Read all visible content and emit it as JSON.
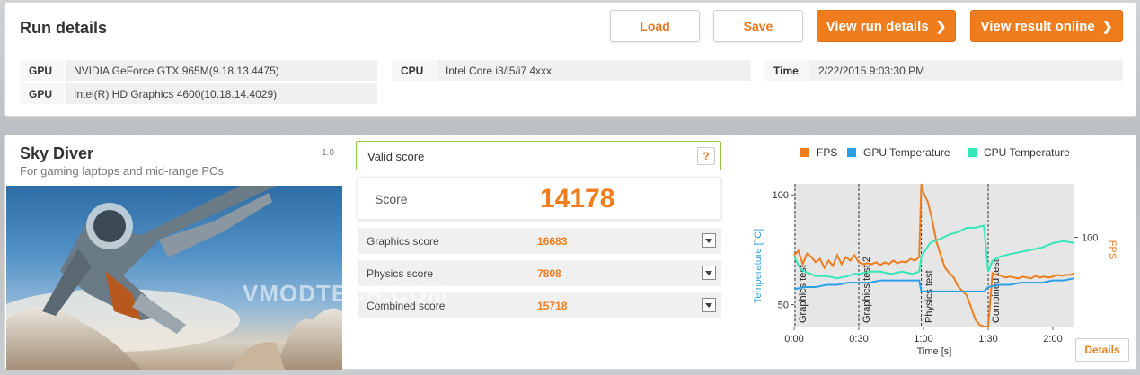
{
  "run": {
    "title": "Run details",
    "buttons": {
      "load": "Load",
      "save": "Save",
      "view_run_details": "View run details",
      "view_result_online": "View result online"
    },
    "info": {
      "gpu_label": "GPU",
      "gpu1": "NVIDIA GeForce GTX 965M(9.18.13.4475)",
      "gpu2": "Intel(R) HD Graphics 4600(10.18.14.4029)",
      "cpu_label": "CPU",
      "cpu": "Intel Core i3/i5/i7 4xxx",
      "time_label": "Time",
      "time": "2/22/2015 9:03:30 PM"
    }
  },
  "benchmark": {
    "title": "Sky Diver",
    "subtitle": "For gaming laptops and mid-range PCs",
    "version": "1.0",
    "valid_label": "Valid score",
    "help": "?",
    "score_label": "Score",
    "score_value": "14178",
    "sub_scores": [
      {
        "label": "Graphics score",
        "value": "16683"
      },
      {
        "label": "Physics score",
        "value": "7808"
      },
      {
        "label": "Combined score",
        "value": "15718"
      }
    ],
    "details_label": "Details"
  },
  "watermark": "VMODTECH.COM",
  "colors": {
    "fps": "#ee7d1d",
    "gpu_temp": "#2aa0e6",
    "cpu_temp": "#35e6b8",
    "accent": "#ef7d1d",
    "valid": "#8dc63f"
  },
  "chart_data": {
    "type": "line",
    "legend": [
      "FPS",
      "GPU Temperature",
      "CPU Temperature"
    ],
    "xlabel": "Time [s]",
    "ylabel_left": "Temperature [°C]",
    "ylabel_right": "FPS",
    "x_ticks": [
      "0:00",
      "0:30",
      "1:00",
      "1:30",
      "2:00"
    ],
    "xlim": [
      0,
      130
    ],
    "y_left_ticks": [
      50,
      100
    ],
    "ylim_left": [
      40,
      105
    ],
    "y_right_ticks": [
      100
    ],
    "ylim_right": [
      0,
      160
    ],
    "sections": [
      {
        "label": "Graphics test",
        "start": 0
      },
      {
        "label": "Graphics test 2",
        "start": 30
      },
      {
        "label": "Physics test",
        "start": 59
      },
      {
        "label": "Combined test",
        "start": 90
      }
    ],
    "series": [
      {
        "name": "FPS",
        "axis": "right",
        "x": [
          0,
          2,
          4,
          6,
          8,
          10,
          12,
          14,
          16,
          18,
          20,
          22,
          24,
          26,
          28,
          30,
          32,
          34,
          36,
          38,
          40,
          42,
          44,
          46,
          48,
          50,
          52,
          54,
          56,
          58,
          59,
          60,
          62,
          64,
          66,
          68,
          70,
          72,
          74,
          76,
          78,
          80,
          82,
          84,
          86,
          88,
          90,
          92,
          94,
          96,
          98,
          100,
          102,
          104,
          106,
          108,
          110,
          112,
          114,
          116,
          118,
          120,
          122,
          124,
          126,
          128,
          130
        ],
        "values": [
          80,
          85,
          70,
          82,
          78,
          72,
          76,
          66,
          74,
          68,
          80,
          70,
          78,
          74,
          80,
          72,
          70,
          71,
          70,
          72,
          69,
          72,
          70,
          74,
          71,
          73,
          72,
          76,
          74,
          78,
          160,
          150,
          140,
          120,
          95,
          80,
          66,
          60,
          55,
          45,
          40,
          35,
          22,
          8,
          2,
          0,
          0,
          60,
          58,
          57,
          55,
          56,
          55,
          54,
          56,
          55,
          54,
          57,
          55,
          56,
          55,
          56,
          58,
          57,
          58,
          58,
          60
        ]
      },
      {
        "name": "GPU Temperature",
        "axis": "left",
        "x": [
          0,
          5,
          10,
          15,
          20,
          25,
          28,
          30,
          35,
          40,
          45,
          50,
          55,
          58,
          59,
          62,
          66,
          70,
          75,
          80,
          85,
          88,
          90,
          95,
          100,
          105,
          110,
          115,
          120,
          125,
          130
        ],
        "values": [
          57,
          58,
          58,
          59,
          59,
          60,
          60,
          60,
          60,
          61,
          61,
          61,
          61,
          61,
          56,
          56,
          56,
          56,
          56,
          56,
          56,
          56,
          58,
          59,
          59,
          60,
          60,
          60,
          61,
          61,
          62
        ]
      },
      {
        "name": "CPU Temperature",
        "axis": "left",
        "x": [
          0,
          3,
          5,
          10,
          15,
          20,
          25,
          28,
          30,
          35,
          40,
          45,
          50,
          55,
          58,
          59,
          61,
          63,
          65,
          68,
          72,
          76,
          80,
          84,
          88,
          90,
          92,
          96,
          100,
          105,
          110,
          115,
          120,
          125,
          130
        ],
        "values": [
          72,
          66,
          65,
          63,
          63,
          62,
          63,
          64,
          64,
          65,
          65,
          64,
          65,
          64,
          65,
          72,
          75,
          78,
          79,
          80,
          82,
          83,
          85,
          85,
          86,
          65,
          70,
          72,
          73,
          74,
          75,
          76,
          78,
          79,
          78
        ]
      }
    ]
  }
}
